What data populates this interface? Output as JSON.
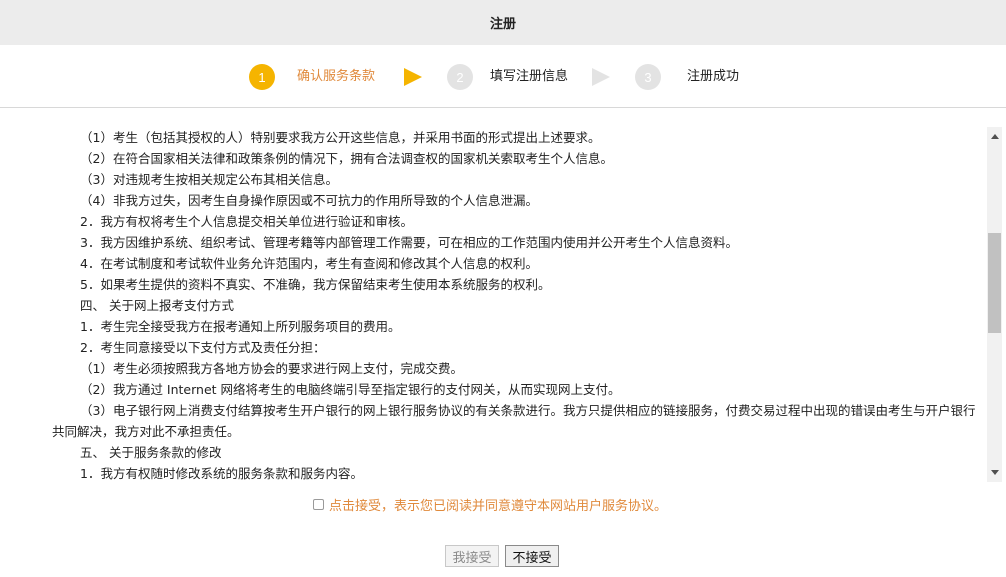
{
  "window": {
    "title": "注册"
  },
  "steps": [
    {
      "number": "1",
      "label": "确认服务条款",
      "active": true
    },
    {
      "number": "2",
      "label": "填写注册信息",
      "active": false
    },
    {
      "number": "3",
      "label": "注册成功",
      "active": false
    }
  ],
  "colors": {
    "accent": "#f5b400",
    "inactive_step": "#e3e3e3",
    "agree_text": "#e08a3c"
  },
  "content": {
    "lines": [
      "（1）考生（包括其授权的人）特别要求我方公开这些信息，并采用书面的形式提出上述要求。",
      "（2）在符合国家相关法律和政策条例的情况下，拥有合法调查权的国家机关索取考生个人信息。",
      "（3）对违规考生按相关规定公布其相关信息。",
      "（4）非我方过失，因考生自身操作原因或不可抗力的作用所导致的个人信息泄漏。",
      "2．我方有权将考生个人信息提交相关单位进行验证和审核。",
      "3．我方因维护系统、组织考试、管理考籍等内部管理工作需要，可在相应的工作范围内使用并公开考生个人信息资料。",
      "4．在考试制度和考试软件业务允许范围内，考生有查阅和修改其个人信息的权利。",
      "5．如果考生提供的资料不真实、不准确，我方保留结束考生使用本系统服务的权利。",
      "四、 关于网上报考支付方式",
      "1．考生完全接受我方在报考通知上所列服务项目的费用。",
      "2．考生同意接受以下支付方式及责任分担：",
      "（1）考生必须按照我方各地方协会的要求进行网上支付，完成交费。",
      "（2）我方通过 Internet 网络将考生的电脑终端引导至指定银行的支付网关，从而实现网上支付。",
      "（3）电子银行网上消费支付结算按考生开户银行的网上银行服务协议的有关条款进行。我方只提供相应的链接服务，付费交易过程中出现的错误由考生与开户银行共同解决，我方对此不承担责任。",
      "五、 关于服务条款的修改",
      "1．我方有权随时修改系统的服务条款和服务内容。"
    ]
  },
  "agreement": {
    "label": "点击接受，表示您已阅读并同意遵守本网站用户服务协议。",
    "checked": false
  },
  "buttons": {
    "accept_label": "我接受",
    "decline_label": "不接受"
  }
}
